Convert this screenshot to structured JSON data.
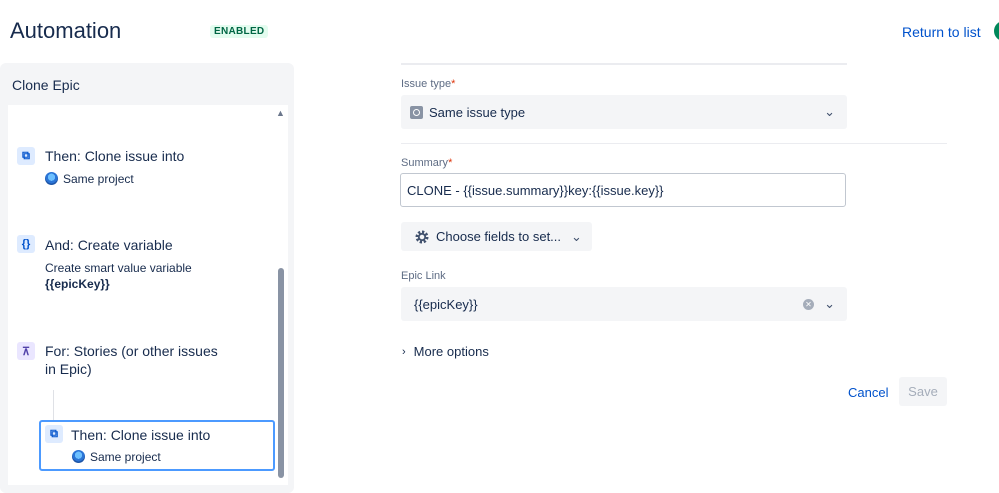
{
  "header": {
    "title": "Automation",
    "badge": "ENABLED",
    "return_link": "Return to list"
  },
  "sidebar": {
    "title": "Clone Epic",
    "steps": [
      {
        "title": "Then: Clone issue into",
        "project": "Same project"
      },
      {
        "title": "And: Create variable",
        "description": "Create smart value variable",
        "variable": "{{epicKey}}"
      },
      {
        "title": "For: Stories (or other issues",
        "title_line2": "in Epic)"
      },
      {
        "title": "Then: Clone issue into",
        "project": "Same project"
      }
    ]
  },
  "form": {
    "issue_type": {
      "label": "Issue type",
      "required_mark": "*",
      "value": "Same issue type"
    },
    "summary": {
      "label": "Summary",
      "required_mark": "*",
      "value": "CLONE - {{issue.summary}}key:{{issue.key}}"
    },
    "choose_fields": {
      "label": "Choose fields to set..."
    },
    "epic_link": {
      "label": "Epic Link",
      "value": "{{epicKey}}"
    },
    "more_options": "More options",
    "cancel": "Cancel",
    "save": "Save"
  },
  "colors": {
    "accent": "#0052cc",
    "badge_bg": "#e3fcef",
    "badge_text": "#006644",
    "selected_border": "#4c9aff"
  }
}
